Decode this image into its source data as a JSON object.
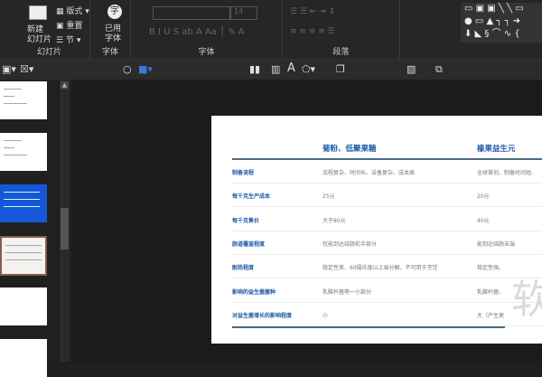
{
  "ribbon": {
    "slides_group": {
      "new_slide": "新建\n幻灯片",
      "layout": "版式",
      "reset": "重置",
      "section": "节",
      "label": "幻灯片"
    },
    "font_used": {
      "label": "已用字体",
      "group_label": "字体",
      "glyph": "字"
    },
    "font_group": {
      "label": "字体",
      "size": "14"
    },
    "paragraph_group": {
      "label": "段落"
    }
  },
  "table": {
    "headers": [
      "菊粉、低聚果糖",
      "橡果益生元"
    ],
    "rows": [
      {
        "label": "制备流程",
        "c1": "流程复杂、时间长、设备复杂、成本高",
        "c2": "全球首创、制备时间短、"
      },
      {
        "label": "每千克生产成本",
        "c1": "25元",
        "c2": "20元"
      },
      {
        "label": "每千克售价",
        "c1": "大于80元",
        "c2": "40元"
      },
      {
        "label": "肠道覆盖程度",
        "c1": "仅能到达结肠前半部分",
        "c2": "能到达结肠末端"
      },
      {
        "label": "耐热程度",
        "c1": "稳定性差、60摄氏度以上易分解，不可用于烹饪",
        "c2": "稳定性强、"
      },
      {
        "label": "影响的益生菌菌种",
        "c1": "乳酸杆菌等一小部分",
        "c2": "乳酸杆菌、"
      },
      {
        "label": "对益生菌增长的影响程度",
        "c1": "小",
        "c2": "大（产生更"
      }
    ]
  },
  "watermark": "软",
  "colors": {
    "accent": "#1e5aa8",
    "selected_thumb": "#1557d8"
  }
}
